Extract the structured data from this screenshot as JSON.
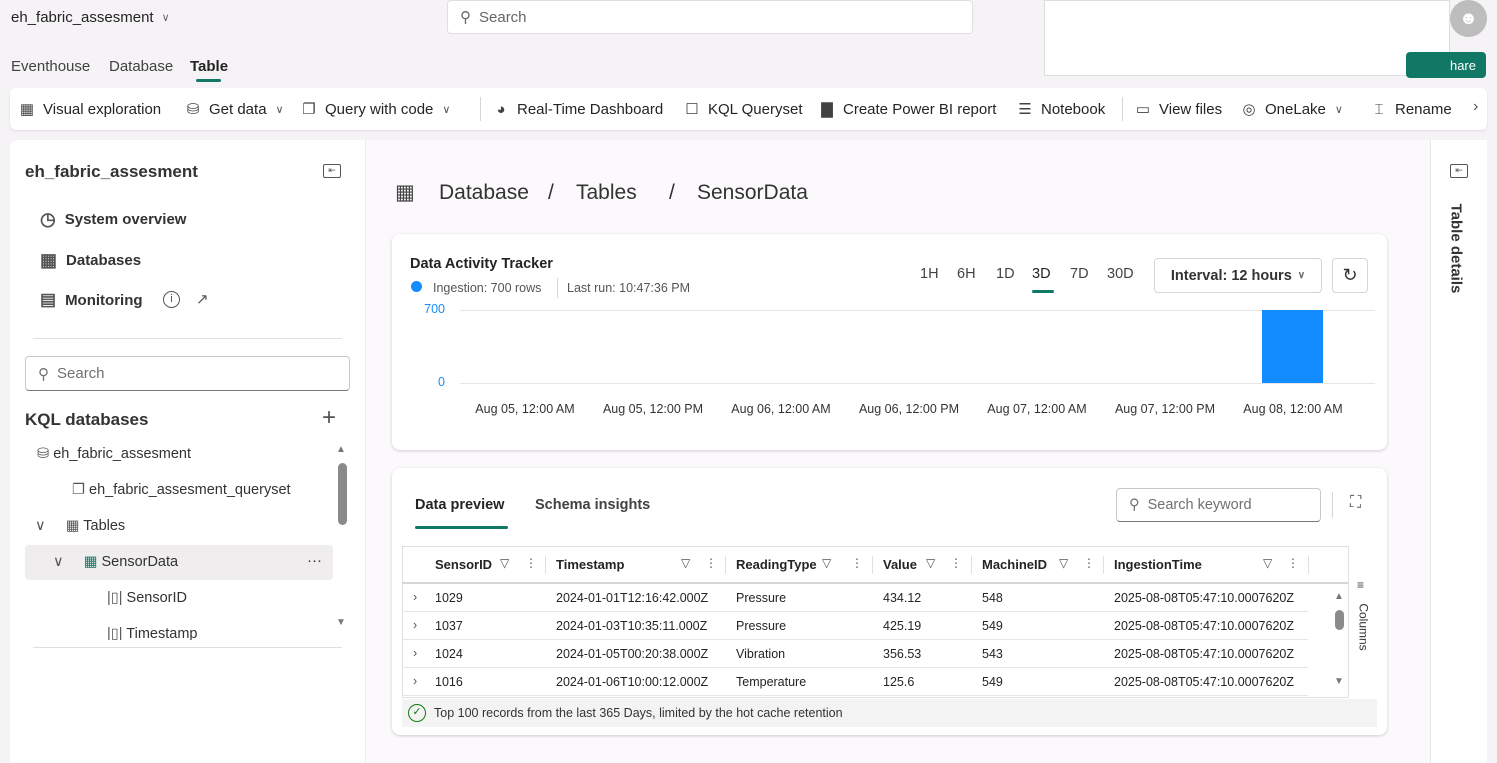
{
  "header": {
    "workspace": "eh_fabric_assesment",
    "search_placeholder": "Search",
    "share_label": "hare"
  },
  "tabs": [
    {
      "label": "Eventhouse"
    },
    {
      "label": "Database"
    },
    {
      "label": "Table",
      "active": true
    }
  ],
  "toolbar": [
    {
      "label": "Visual exploration",
      "icon": "visual-exploration-icon"
    },
    {
      "label": "Get data",
      "icon": "get-data-icon",
      "dropdown": true
    },
    {
      "label": "Query with code",
      "icon": "query-icon",
      "dropdown": true
    },
    {
      "label": "Real-Time Dashboard",
      "icon": "dashboard-icon"
    },
    {
      "label": "KQL Queryset",
      "icon": "queryset-icon"
    },
    {
      "label": "Create Power BI report",
      "icon": "powerbi-icon"
    },
    {
      "label": "Notebook",
      "icon": "notebook-icon"
    },
    {
      "label": "View files",
      "icon": "folder-icon"
    },
    {
      "label": "OneLake",
      "icon": "onelake-icon",
      "dropdown": true
    },
    {
      "label": "Rename",
      "icon": "rename-icon"
    }
  ],
  "sidebar": {
    "title": "eh_fabric_assesment",
    "nav": [
      {
        "label": "System overview"
      },
      {
        "label": "Databases"
      },
      {
        "label": "Monitoring"
      }
    ],
    "search_placeholder": "Search",
    "section": "KQL databases",
    "tree": [
      {
        "label": "eh_fabric_assesment"
      },
      {
        "label": "eh_fabric_assesment_queryset"
      },
      {
        "label": "Tables"
      },
      {
        "label": "SensorData",
        "selected": true
      },
      {
        "label": "SensorID"
      },
      {
        "label": "Timestamp"
      }
    ]
  },
  "breadcrumb": [
    "Database",
    "/",
    "Tables",
    "/",
    "SensorData"
  ],
  "tracker": {
    "title": "Data Activity Tracker",
    "ingestion": "Ingestion: 700 rows",
    "last_run": "Last run: 10:47:36 PM",
    "ranges": [
      "1H",
      "6H",
      "1D",
      "3D",
      "7D",
      "30D"
    ],
    "active_range": "3D",
    "interval": "Interval: 12 hours",
    "accent": "#118dff"
  },
  "chart_data": {
    "type": "bar",
    "x": [
      "Aug 08, 12:00 AM"
    ],
    "values": [
      700
    ],
    "xticks": [
      "Aug 05, 12:00 AM",
      "Aug 05, 12:00 PM",
      "Aug 06, 12:00 AM",
      "Aug 06, 12:00 PM",
      "Aug 07, 12:00 AM",
      "Aug 07, 12:00 PM",
      "Aug 08, 12:00 AM"
    ],
    "yticks": [
      "700",
      "0"
    ],
    "ylim": [
      0,
      700
    ],
    "color": "#118dff",
    "grid": true
  },
  "preview": {
    "tabs": [
      "Data preview",
      "Schema insights"
    ],
    "search_placeholder": "Search keyword",
    "columns_label": "Columns",
    "headers": [
      "SensorID",
      "Timestamp",
      "ReadingType",
      "Value",
      "MachineID",
      "IngestionTime"
    ],
    "rows": [
      [
        "1029",
        "2024-01-01T12:16:42.000Z",
        "Pressure",
        "434.12",
        "548",
        "2025-08-08T05:47:10.0007620Z"
      ],
      [
        "1037",
        "2024-01-03T10:35:11.000Z",
        "Pressure",
        "425.19",
        "549",
        "2025-08-08T05:47:10.0007620Z"
      ],
      [
        "1024",
        "2024-01-05T00:20:38.000Z",
        "Vibration",
        "356.53",
        "543",
        "2025-08-08T05:47:10.0007620Z"
      ],
      [
        "1016",
        "2024-01-06T10:00:12.000Z",
        "Temperature",
        "125.6",
        "549",
        "2025-08-08T05:47:10.0007620Z"
      ]
    ],
    "footer": "Top 100 records from the last 365 Days, limited by the hot cache retention"
  },
  "right_panel": {
    "label": "Table details"
  }
}
